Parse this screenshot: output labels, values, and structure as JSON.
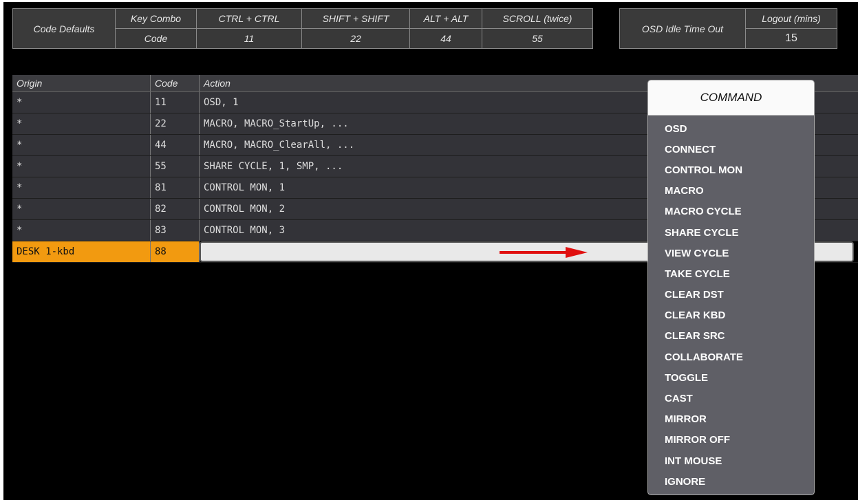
{
  "defaults": {
    "row_label": "Code Defaults",
    "key_combo_label": "Key Combo",
    "code_label": "Code",
    "combos": [
      {
        "name": "CTRL + CTRL",
        "code": "11"
      },
      {
        "name": "SHIFT + SHIFT",
        "code": "22"
      },
      {
        "name": "ALT + ALT",
        "code": "44"
      },
      {
        "name": "SCROLL (twice)",
        "code": "55"
      }
    ]
  },
  "idle": {
    "label": "OSD Idle Time Out",
    "logout_label": "Logout (mins)",
    "logout_value": "15"
  },
  "table": {
    "headers": {
      "origin": "Origin",
      "code": "Code",
      "action": "Action"
    },
    "rows": [
      {
        "origin": "*",
        "code": "11",
        "action": "OSD, 1"
      },
      {
        "origin": "*",
        "code": "22",
        "action": "MACRO, MACRO_StartUp, ..."
      },
      {
        "origin": "*",
        "code": "44",
        "action": "MACRO, MACRO_ClearAll, ..."
      },
      {
        "origin": "*",
        "code": "55",
        "action": "SHARE CYCLE, 1, SMP, ..."
      },
      {
        "origin": "*",
        "code": "81",
        "action": "CONTROL MON, 1"
      },
      {
        "origin": "*",
        "code": "82",
        "action": "CONTROL MON, 2"
      },
      {
        "origin": "*",
        "code": "83",
        "action": "CONTROL MON, 3"
      }
    ],
    "selected": {
      "origin": "DESK 1-kbd",
      "code": "88",
      "action": ""
    }
  },
  "command_menu": {
    "title": "COMMAND",
    "items": [
      "OSD",
      "CONNECT",
      "CONTROL MON",
      "MACRO",
      "MACRO CYCLE",
      "SHARE CYCLE",
      "VIEW CYCLE",
      "TAKE CYCLE",
      "CLEAR DST",
      "CLEAR KBD",
      "CLEAR SRC",
      "COLLABORATE",
      "TOGGLE",
      "CAST",
      "MIRROR",
      "MIRROR OFF",
      "INT MOUSE",
      "IGNORE"
    ]
  },
  "colors": {
    "selected": "#f29a10",
    "arrow": "#e01010"
  }
}
